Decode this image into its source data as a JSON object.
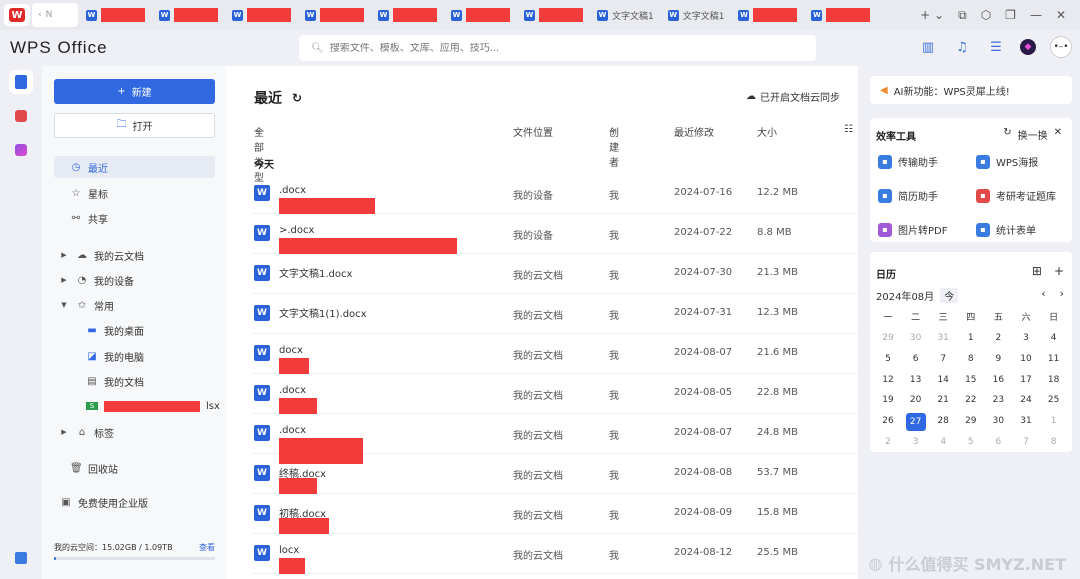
{
  "tabs": [
    {
      "label": "N",
      "type": "home"
    },
    {
      "label": "",
      "redacted": true
    },
    {
      "label": "",
      "redacted": true
    },
    {
      "label": "",
      "redacted": true
    },
    {
      "label": "",
      "redacted": true
    },
    {
      "label": "",
      "redacted": true
    },
    {
      "label": "",
      "redacted": true
    },
    {
      "label": "",
      "redacted": true
    },
    {
      "label": "文字文稿1",
      "redacted": false
    },
    {
      "label": "文字文稿1",
      "redacted": false
    },
    {
      "label": "",
      "redacted": true
    },
    {
      "label": "",
      "redacted": true
    }
  ],
  "header": {
    "brand": "WPS Office",
    "search_placeholder": "搜索文件、模板、文库、应用、技巧..."
  },
  "sidebar": {
    "new_label": "新建",
    "open_label": "打开",
    "nav": [
      {
        "label": "最近",
        "icon": "clock-icon"
      },
      {
        "label": "星标",
        "icon": "star-icon"
      },
      {
        "label": "共享",
        "icon": "share-icon"
      }
    ],
    "tree": [
      {
        "label": "我的云文档"
      },
      {
        "label": "我的设备"
      },
      {
        "label": "常用"
      }
    ],
    "common_items": [
      {
        "label": "我的桌面"
      },
      {
        "label": "我的电脑"
      },
      {
        "label": "我的文档"
      },
      {
        "label": "lsx"
      }
    ],
    "tags_label": "标签",
    "recycle_label": "回收站",
    "enterprise_label": "免费使用企业版",
    "storage_text": "我的云空间：15.02GB / 1.09TB",
    "storage_view": "查看",
    "storage_fraction": 0.013
  },
  "main": {
    "title": "最近",
    "sync_label": "已开启文档云同步",
    "columns": {
      "type": "全部类型",
      "location": "文件位置",
      "creator": "创建者",
      "modified": "最近修改",
      "size": "大小"
    },
    "group_label": "今天",
    "files": [
      {
        "name_suffix": ".docx",
        "location": "我的设备",
        "creator": "我",
        "modified": "2024-07-16",
        "size": "12.2 MB",
        "redacted": true
      },
      {
        "name_suffix": ">.docx",
        "location": "我的设备",
        "creator": "我",
        "modified": "2024-07-22",
        "size": "8.8 MB",
        "redacted": true
      },
      {
        "name_suffix": "文字文稿1.docx",
        "location": "我的云文档",
        "creator": "我",
        "modified": "2024-07-30",
        "size": "21.3 MB",
        "redacted": false
      },
      {
        "name_suffix": "文字文稿1(1).docx",
        "location": "我的云文档",
        "creator": "我",
        "modified": "2024-07-31",
        "size": "12.3 MB",
        "redacted": false
      },
      {
        "name_suffix": "docx",
        "location": "我的云文档",
        "creator": "我",
        "modified": "2024-08-07",
        "size": "21.6 MB",
        "redacted": true
      },
      {
        "name_suffix": ".docx",
        "location": "我的云文档",
        "creator": "我",
        "modified": "2024-08-05",
        "size": "22.8 MB",
        "redacted": true
      },
      {
        "name_suffix": ".docx",
        "location": "我的云文档",
        "creator": "我",
        "modified": "2024-08-07",
        "size": "24.8 MB",
        "redacted": true
      },
      {
        "name_suffix": "终稿.docx",
        "location": "我的云文档",
        "creator": "我",
        "modified": "2024-08-08",
        "size": "53.7 MB",
        "redacted": true
      },
      {
        "name_suffix": "初稿.docx",
        "location": "我的云文档",
        "creator": "我",
        "modified": "2024-08-09",
        "size": "15.8 MB",
        "redacted": true
      },
      {
        "name_suffix": "locx",
        "location": "我的云文档",
        "creator": "我",
        "modified": "2024-08-12",
        "size": "25.5 MB",
        "redacted": true
      }
    ]
  },
  "rpanel": {
    "banner": "AI新功能：WPS灵犀上线!",
    "tools_title": "效率工具",
    "tools_refresh": "换一换",
    "tools": [
      {
        "label": "传输助手",
        "color": "#3a7be0"
      },
      {
        "label": "WPS海报",
        "color": "#3a7be0"
      },
      {
        "label": "简历助手",
        "color": "#3a7be0"
      },
      {
        "label": "考研考证题库",
        "color": "#e04a4a"
      },
      {
        "label": "图片转PDF",
        "color": "#a05ad8"
      },
      {
        "label": "统计表单",
        "color": "#3a7be0"
      }
    ],
    "calendar": {
      "title": "日历",
      "month": "2024年08月",
      "today_btn": "今",
      "weekdays": [
        "一",
        "二",
        "三",
        "四",
        "五",
        "六",
        "日"
      ],
      "days": [
        [
          "29",
          "30",
          "31",
          "1",
          "2",
          "3",
          "4"
        ],
        [
          "5",
          "6",
          "7",
          "8",
          "9",
          "10",
          "11"
        ],
        [
          "12",
          "13",
          "14",
          "15",
          "16",
          "17",
          "18"
        ],
        [
          "19",
          "20",
          "21",
          "22",
          "23",
          "24",
          "25"
        ],
        [
          "26",
          "27",
          "28",
          "29",
          "30",
          "31",
          "1"
        ],
        [
          "2",
          "3",
          "4",
          "5",
          "6",
          "7",
          "8"
        ]
      ],
      "selected": "27"
    }
  },
  "watermark": "什么值得买 SMYZ.NET"
}
